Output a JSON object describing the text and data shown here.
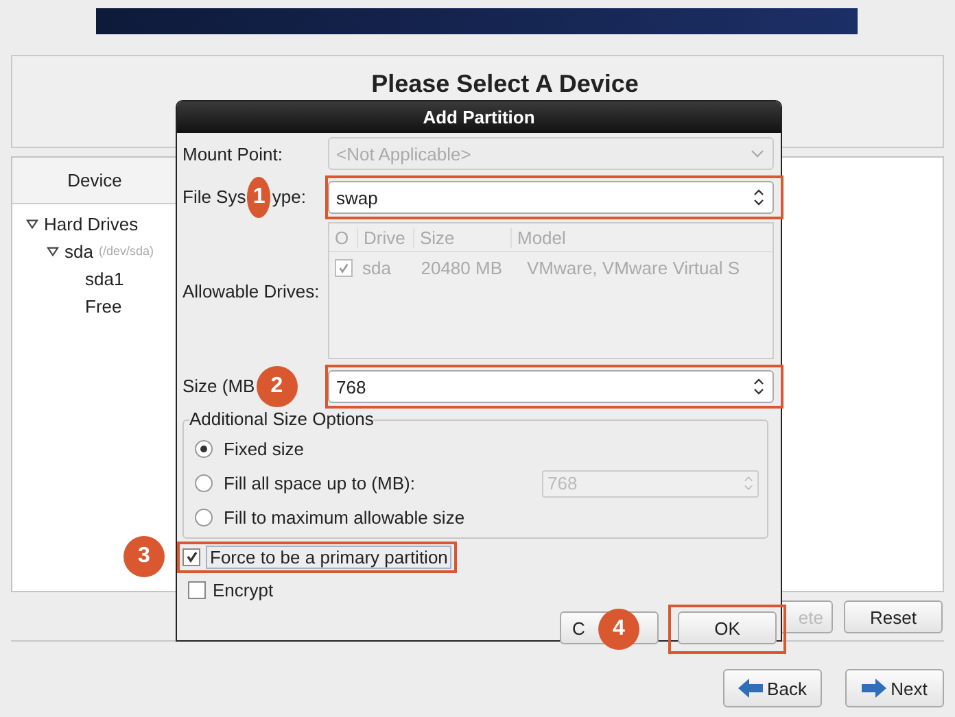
{
  "page": {
    "heading": "Please Select A Device",
    "device_column": "Device",
    "tree": [
      {
        "label": "Hard Drives",
        "expanded": true,
        "children": [
          {
            "label": "sda",
            "detail": "(/dev/sda)",
            "expanded": true,
            "children": [
              {
                "label": "sda1"
              },
              {
                "label": "Free"
              }
            ]
          }
        ]
      }
    ],
    "buttons": [
      {
        "label": "ete",
        "disabled": true
      },
      {
        "label": "Reset",
        "disabled": false
      }
    ],
    "nav": [
      {
        "label": "Back",
        "kind": "back"
      },
      {
        "label": "Next",
        "kind": "next"
      }
    ]
  },
  "dialog": {
    "title": "Add Partition",
    "mount_point": {
      "label": "Mount Point:",
      "value": "<Not Applicable>",
      "disabled": true
    },
    "fs_type": {
      "label_start": "File Sys",
      "label_end": "ype:",
      "callout": "1",
      "value": "swap",
      "highlighted": true
    },
    "drives": {
      "label": "Allowable Drives:",
      "columns": [
        "O",
        "Drive",
        "Size",
        "Model"
      ],
      "rows": [
        {
          "checked": true,
          "drive": "sda",
          "size": "20480 MB",
          "model": "VMware, VMware Virtual S"
        }
      ]
    },
    "size": {
      "label": "Size (MB",
      "callout": "2",
      "value": "768",
      "highlighted": true
    },
    "size_options": {
      "title": "Additional Size Options",
      "options": [
        {
          "label": "Fixed size",
          "selected": true
        },
        {
          "label": "Fill all space up to (MB):",
          "selected": false,
          "value": "768"
        },
        {
          "label": "Fill to maximum allowable size",
          "selected": false
        }
      ]
    },
    "checks": [
      {
        "label": "Force to be a primary partition",
        "checked": true,
        "highlighted": true,
        "callout": "3"
      },
      {
        "label": "Encrypt",
        "checked": false,
        "highlighted": false
      }
    ],
    "buttons": [
      {
        "label": "C",
        "callout": "4",
        "highlighted": false
      },
      {
        "label": "OK",
        "highlighted": true
      }
    ]
  }
}
